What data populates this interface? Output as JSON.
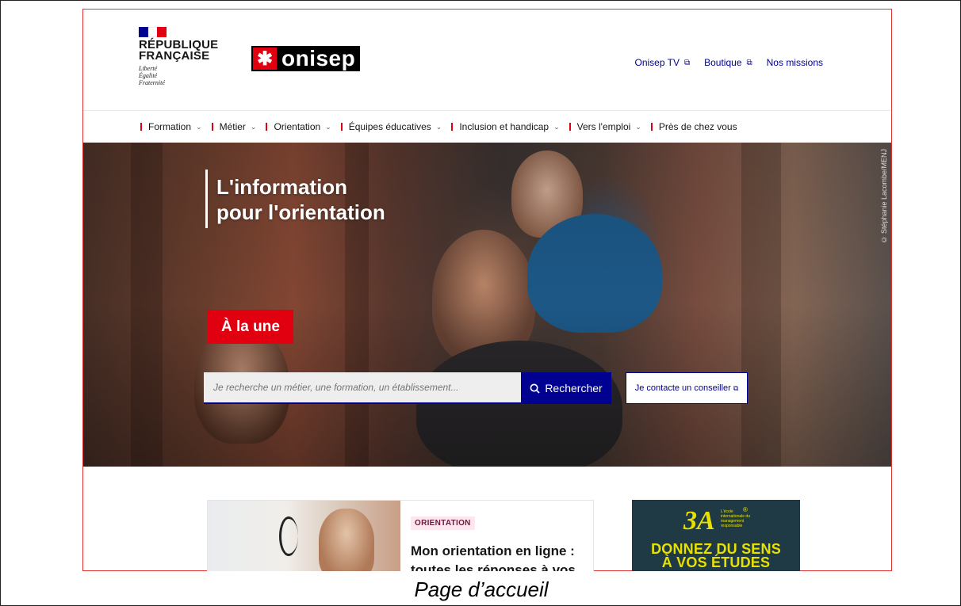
{
  "colors": {
    "accent_blue": "#000091",
    "accent_red": "#e1000f",
    "tag_bg": "#fde7ef"
  },
  "gov_logo": {
    "title_line1": "RÉPUBLIQUE",
    "title_line2": "FRANÇAISE",
    "motto_line1": "Liberté",
    "motto_line2": "Égalité",
    "motto_line3": "Fraternité"
  },
  "brand": {
    "name": "onisep",
    "icon": "asterisk-icon"
  },
  "top_links": [
    {
      "label": "Onisep TV",
      "external": true
    },
    {
      "label": "Boutique",
      "external": true
    },
    {
      "label": "Nos missions",
      "external": false
    }
  ],
  "nav": [
    {
      "label": "Formation",
      "dropdown": true
    },
    {
      "label": "Métier",
      "dropdown": true
    },
    {
      "label": "Orientation",
      "dropdown": true
    },
    {
      "label": "Équipes éducatives",
      "dropdown": true
    },
    {
      "label": "Inclusion et handicap",
      "dropdown": true
    },
    {
      "label": "Vers l'emploi",
      "dropdown": true
    },
    {
      "label": "Près de chez vous",
      "dropdown": false
    }
  ],
  "hero": {
    "title_line1": "L'information",
    "title_line2": "pour l'orientation",
    "credit": "© Stéphanie Lacombe/MENJ"
  },
  "search": {
    "placeholder": "Je recherche un métier, une formation, un établissement...",
    "button_label": "Rechercher",
    "contact_label": "Je contacte un conseiller"
  },
  "alaune": {
    "label": "À la une"
  },
  "card": {
    "tag": "ORIENTATION",
    "title": "Mon orientation en ligne : toutes les réponses à vos"
  },
  "ad": {
    "logo": "3A",
    "subtext": "L'école internationale du management responsable",
    "line1": "DONNEZ DU SENS",
    "line2": "À VOS ÉTUDES"
  },
  "caption": "Page d’accueil"
}
